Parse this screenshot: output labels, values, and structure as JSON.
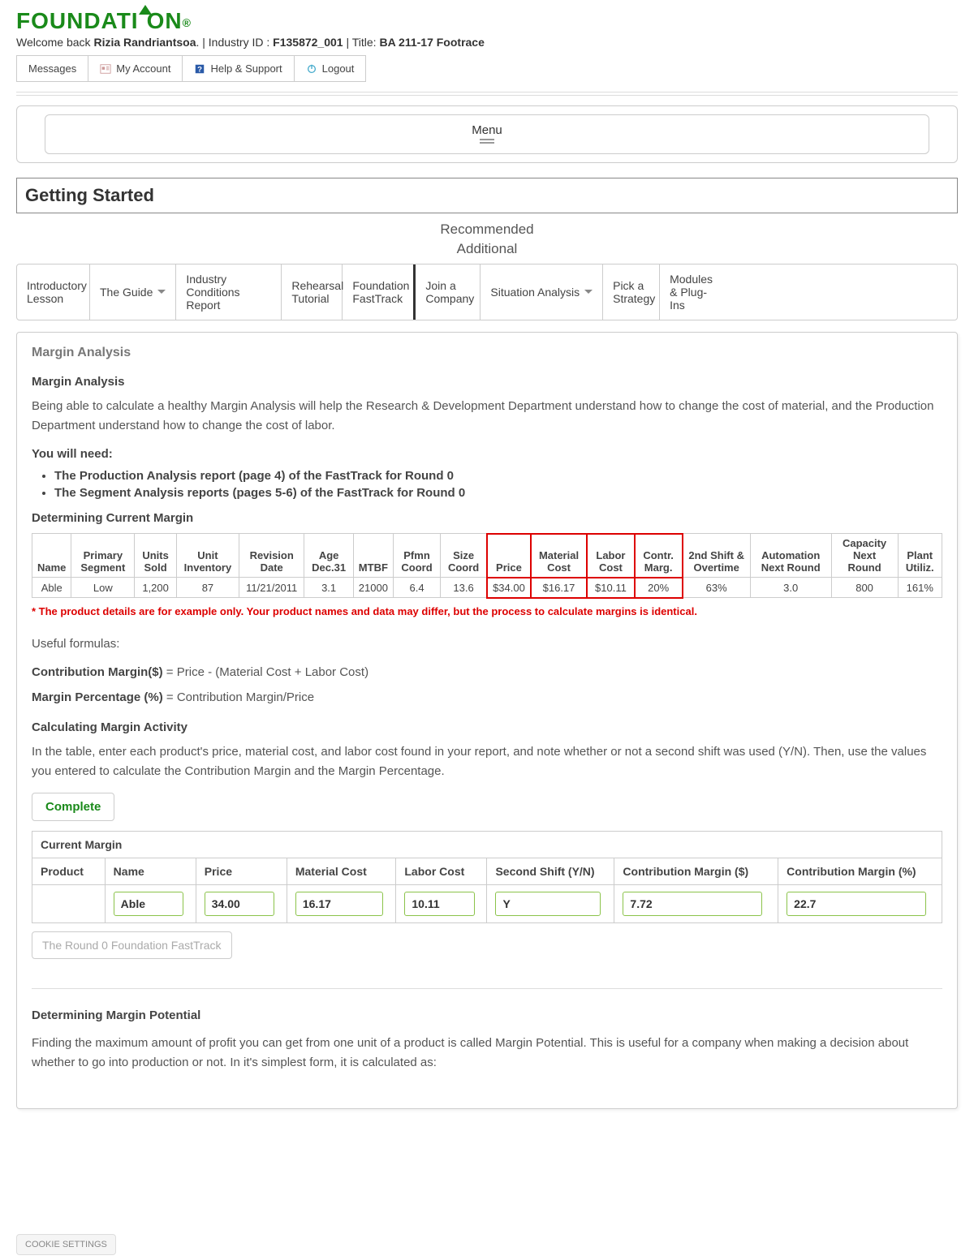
{
  "header": {
    "welcome_prefix": "Welcome back ",
    "user_name": "Rizia Randriantsoa",
    "industry_label": ". | Industry ID : ",
    "industry_id": "F135872_001",
    "title_label": " | Title: ",
    "title": "BA 211-17 Footrace"
  },
  "top_nav": {
    "messages": "Messages",
    "my_account": "My Account",
    "help_support": "Help & Support",
    "logout": "Logout"
  },
  "menu_label": "Menu",
  "page_title": "Getting Started",
  "subheader_line1": "Recommended",
  "subheader_line2": "Additional",
  "tabs": {
    "intro": "Introductory Lesson",
    "guide": "The Guide",
    "industry": "Industry Conditions Report",
    "rehearsal": "Rehearsal Tutorial",
    "fasttrack": "Foundation FastTrack",
    "join": "Join a Company",
    "situation": "Situation Analysis",
    "strategy": "Pick a Strategy",
    "modules": "Modules & Plug-Ins"
  },
  "content": {
    "section_label": "Margin Analysis",
    "heading1": "Margin Analysis",
    "intro_para": "Being able to calculate a healthy Margin Analysis will help the Research & Development Department understand how to change the cost of material, and the Production Department  understand how to change the cost of labor.",
    "need_label": "You will need:",
    "needs": [
      "The Production Analysis report (page 4) of the FastTrack for Round 0",
      "The Segment Analysis reports (pages 5-6) of the FastTrack for Round 0"
    ],
    "determining_heading": "Determining Current Margin",
    "table": {
      "headers": [
        "Name",
        "Primary Segment",
        "Units Sold",
        "Unit Inventory",
        "Revision Date",
        "Age Dec.31",
        "MTBF",
        "Pfmn Coord",
        "Size Coord",
        "Price",
        "Material Cost",
        "Labor Cost",
        "Contr. Marg.",
        "2nd Shift & Overtime",
        "Automation Next Round",
        "Capacity Next Round",
        "Plant Utiliz."
      ],
      "row": [
        "Able",
        "Low",
        "1,200",
        "87",
        "11/21/2011",
        "3.1",
        "21000",
        "6.4",
        "13.6",
        "$34.00",
        "$16.17",
        "$10.11",
        "20%",
        "63%",
        "3.0",
        "800",
        "161%"
      ]
    },
    "red_note": "* The product details are for example only. Your product names and data may differ, but the process to calculate margins is identical.",
    "useful_formulas": "Useful formulas:",
    "formula1_label": "Contribution Margin($)",
    "formula1_rest": " = Price - (Material Cost + Labor Cost)",
    "formula2_label": "Margin Percentage (%)",
    "formula2_rest": " = Contribution Margin/Price",
    "calc_heading": "Calculating Margin Activity",
    "calc_para": "In the table, enter each product's price, material cost, and labor cost found in your report, and note whether or not a second shift was used (Y/N). Then, use the values you entered to calculate the Contribution Margin and the Margin Percentage.",
    "complete_btn": "Complete",
    "current_margin_label": "Current Margin",
    "input_headers": [
      "Product",
      "Name",
      "Price",
      "Material Cost",
      "Labor Cost",
      "Second Shift (Y/N)",
      "Contribution Margin ($)",
      "Contribution Margin (%)"
    ],
    "input_row": {
      "name": "Able",
      "price": "34.00",
      "material": "16.17",
      "labor": "10.11",
      "second_shift": "Y",
      "contrib_dollar": "7.72",
      "contrib_pct": "22.7"
    },
    "fasttrack_btn": "The Round 0 Foundation FastTrack",
    "potential_heading": "Determining Margin Potential",
    "potential_para": "Finding the maximum amount of profit you can get from one unit of a product is called Margin Potential. This is useful for a company when making a decision about whether to go into production or not. In it's simplest form, it is calculated as:"
  },
  "cookie_settings": "COOKIE SETTINGS"
}
